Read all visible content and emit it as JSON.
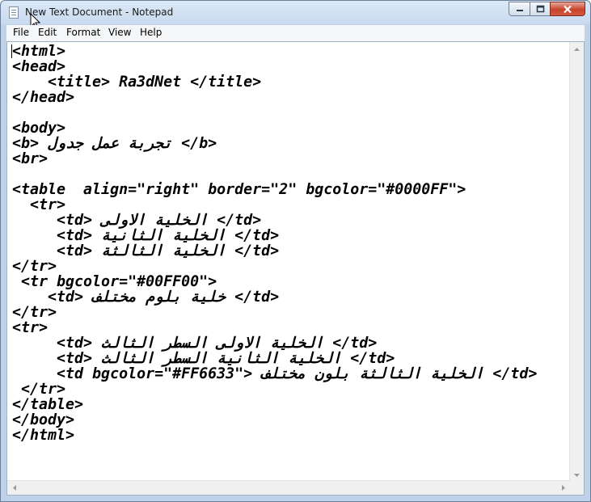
{
  "window": {
    "title": "New Text Document - Notepad"
  },
  "menu": [
    "File",
    "Edit",
    "Format",
    "View",
    "Help"
  ],
  "editor": {
    "lines": [
      "<html>",
      "<head>",
      "    <title> Ra3dNet </title>",
      "</head>",
      "",
      "<body>",
      "<b> تجربة عمل جدول </b>",
      "<br>",
      "",
      "<table  align=\"right\" border=\"2\" bgcolor=\"#0000FF\">",
      "  <tr>",
      "     <td> الخلية الاولى </td>",
      "     <td> الخلية الثانية </td>",
      "     <td> الخلية الثالثة </td>",
      "</tr>",
      " <tr bgcolor=\"#00FF00\">",
      "    <td> خلية بلوم مختلف </td>",
      "</tr>",
      "<tr>",
      "     <td> الخلية الاولى السطر الثالث </td>",
      "     <td> الخلية الثانية السطر الثالث </td>",
      "     <td bgcolor=\"#FF6633\"> الخلية الثالثة بلون مختلف </td>",
      " </tr>",
      "</table>",
      "</body>",
      "</html>"
    ]
  },
  "icons": {
    "app": "notepad-icon",
    "minimize": "minimize-icon",
    "maximize": "maximize-icon",
    "close": "close-icon",
    "cursor": "mouse-cursor-icon"
  },
  "colors": {
    "close_button": "#c7442b",
    "titlebar": "#c9dbef"
  }
}
